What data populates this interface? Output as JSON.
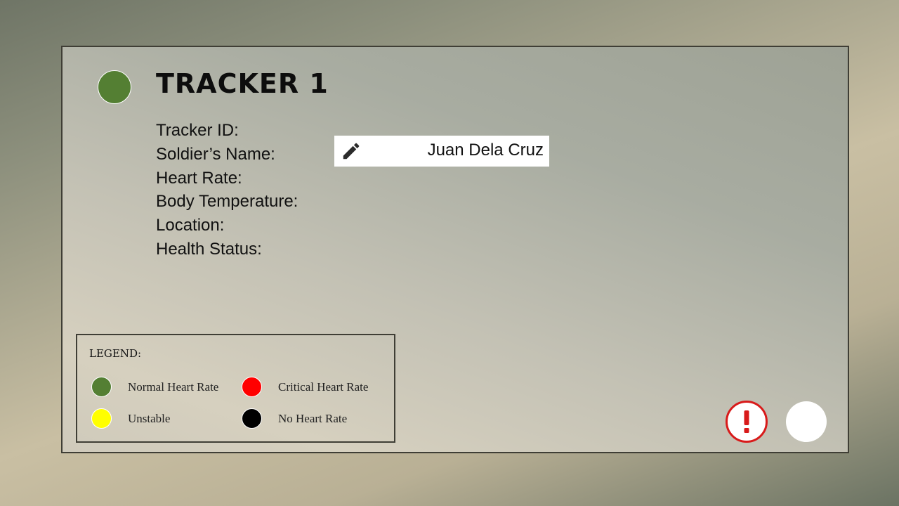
{
  "tracker": {
    "title": "TRACKER 1",
    "status_color": "#547f33",
    "fields": [
      "Tracker ID:",
      "Soldier’s Name:",
      "Heart Rate:",
      "Body Temperature:",
      "Location:",
      "Health Status:"
    ],
    "soldier_name": "Juan Dela Cruz",
    "edit_icon": "pencil-icon"
  },
  "legend": {
    "title": "LEGEND:",
    "items": [
      {
        "label": "Normal Heart Rate",
        "color": "#547f33"
      },
      {
        "label": "Critical Heart Rate",
        "color": "#ff0000"
      },
      {
        "label": "Unstable",
        "color": "#ffff00"
      },
      {
        "label": "No Heart Rate",
        "color": "#000000"
      }
    ]
  },
  "actions": {
    "alert_icon": "exclamation-icon",
    "alert_color": "#d81a1a"
  }
}
